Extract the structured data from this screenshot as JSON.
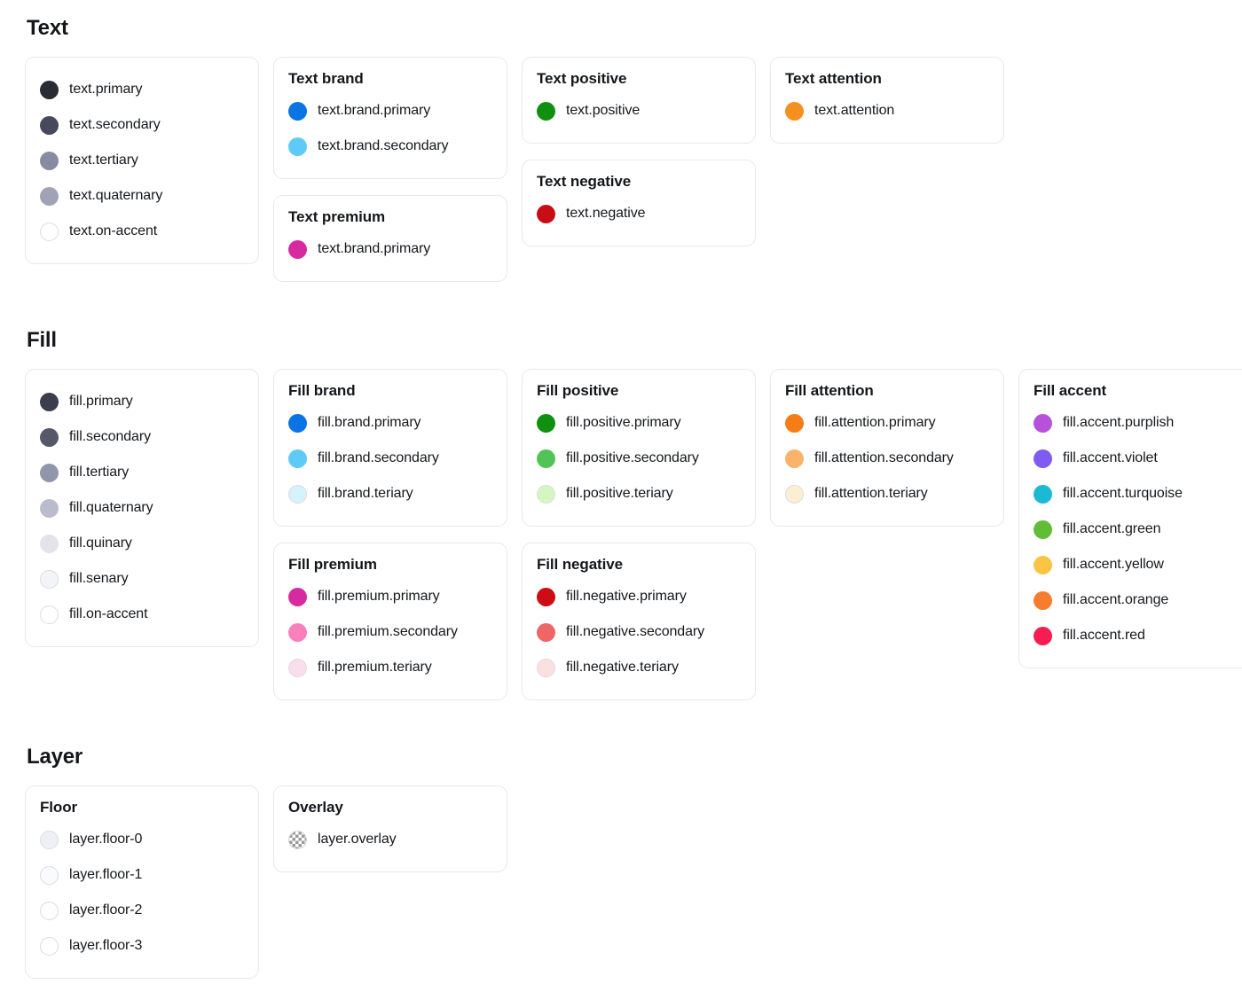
{
  "sections": [
    {
      "id": "text",
      "title": "Text",
      "columns": [
        {
          "cards": [
            {
              "title": null,
              "name": "text-base-card",
              "tokens": [
                {
                  "label": "text.primary",
                  "color": "#292b35",
                  "light": false
                },
                {
                  "label": "text.secondary",
                  "color": "#474a5c",
                  "light": false
                },
                {
                  "label": "text.tertiary",
                  "color": "#888ca3",
                  "light": false
                },
                {
                  "label": "text.quaternary",
                  "color": "#a0a3b5",
                  "light": false
                },
                {
                  "label": "text.on-accent",
                  "color": "#ffffff",
                  "light": true
                }
              ]
            }
          ]
        },
        {
          "cards": [
            {
              "title": "Text brand",
              "name": "text-brand-card",
              "tokens": [
                {
                  "label": "text.brand.primary",
                  "color": "#0b74e5",
                  "light": false
                },
                {
                  "label": "text.brand.secondary",
                  "color": "#5ecbf7",
                  "light": false
                }
              ]
            },
            {
              "title": "Text premium",
              "name": "text-premium-card",
              "tokens": [
                {
                  "label": "text.brand.primary",
                  "color": "#d62ba0",
                  "light": false
                }
              ]
            }
          ]
        },
        {
          "cards": [
            {
              "title": "Text positive",
              "name": "text-positive-card",
              "tokens": [
                {
                  "label": "text.positive",
                  "color": "#109010",
                  "light": false
                }
              ]
            },
            {
              "title": "Text negative",
              "name": "text-negative-card",
              "tokens": [
                {
                  "label": "text.negative",
                  "color": "#c80d16",
                  "light": false
                }
              ]
            }
          ]
        },
        {
          "cards": [
            {
              "title": "Text attention",
              "name": "text-attention-card",
              "tokens": [
                {
                  "label": "text.attention",
                  "color": "#f5901e",
                  "light": false
                }
              ]
            }
          ]
        }
      ]
    },
    {
      "id": "fill",
      "title": "Fill",
      "columns": [
        {
          "cards": [
            {
              "title": null,
              "name": "fill-base-card",
              "tokens": [
                {
                  "label": "fill.primary",
                  "color": "#3b3e4c",
                  "light": false
                },
                {
                  "label": "fill.secondary",
                  "color": "#545869",
                  "light": false
                },
                {
                  "label": "fill.tertiary",
                  "color": "#9296ab",
                  "light": false
                },
                {
                  "label": "fill.quaternary",
                  "color": "#b9bcca",
                  "light": false
                },
                {
                  "label": "fill.quinary",
                  "color": "#e2e4ea",
                  "light": false
                },
                {
                  "label": "fill.senary",
                  "color": "#f2f4f8",
                  "light": true
                },
                {
                  "label": "fill.on-accent",
                  "color": "#ffffff",
                  "light": true
                }
              ]
            }
          ]
        },
        {
          "cards": [
            {
              "title": "Fill brand",
              "name": "fill-brand-card",
              "tokens": [
                {
                  "label": "fill.brand.primary",
                  "color": "#0b74e5",
                  "light": false
                },
                {
                  "label": "fill.brand.secondary",
                  "color": "#5ecbf7",
                  "light": false
                },
                {
                  "label": "fill.brand.teriary",
                  "color": "#d6f2fb",
                  "light": true
                }
              ]
            },
            {
              "title": "Fill premium",
              "name": "fill-premium-card",
              "tokens": [
                {
                  "label": "fill.premium.primary",
                  "color": "#d62ba0",
                  "light": false
                },
                {
                  "label": "fill.premium.secondary",
                  "color": "#fa7fbd",
                  "light": false
                },
                {
                  "label": "fill.premium.teriary",
                  "color": "#fbdeeb",
                  "light": true
                }
              ]
            }
          ]
        },
        {
          "cards": [
            {
              "title": "Fill positive",
              "name": "fill-positive-card",
              "tokens": [
                {
                  "label": "fill.positive.primary",
                  "color": "#109010",
                  "light": false
                },
                {
                  "label": "fill.positive.secondary",
                  "color": "#52c455",
                  "light": false
                },
                {
                  "label": "fill.positive.teriary",
                  "color": "#d4f7c2",
                  "light": true
                }
              ]
            },
            {
              "title": "Fill negative",
              "name": "fill-negative-card",
              "tokens": [
                {
                  "label": "fill.negative.primary",
                  "color": "#cd0c13",
                  "light": false
                },
                {
                  "label": "fill.negative.secondary",
                  "color": "#ef6666",
                  "light": false
                },
                {
                  "label": "fill.negative.teriary",
                  "color": "#fbe0e0",
                  "light": true
                }
              ]
            }
          ]
        },
        {
          "cards": [
            {
              "title": "Fill attention",
              "name": "fill-attention-card",
              "tokens": [
                {
                  "label": "fill.attention.primary",
                  "color": "#f57c16",
                  "light": false
                },
                {
                  "label": "fill.attention.secondary",
                  "color": "#fbb36c",
                  "light": false
                },
                {
                  "label": "fill.attention.teriary",
                  "color": "#fbeed1",
                  "light": true
                }
              ]
            }
          ]
        },
        {
          "cards": [
            {
              "title": "Fill accent",
              "name": "fill-accent-card",
              "tokens": [
                {
                  "label": "fill.accent.purplish",
                  "color": "#b751db",
                  "light": false
                },
                {
                  "label": "fill.accent.violet",
                  "color": "#7f5bf2",
                  "light": false
                },
                {
                  "label": "fill.accent.turquoise",
                  "color": "#1bb9d4",
                  "light": false
                },
                {
                  "label": "fill.accent.green",
                  "color": "#61bd35",
                  "light": false
                },
                {
                  "label": "fill.accent.yellow",
                  "color": "#fbc543",
                  "light": false
                },
                {
                  "label": "fill.accent.orange",
                  "color": "#f77c2e",
                  "light": false
                },
                {
                  "label": "fill.accent.red",
                  "color": "#f51d52",
                  "light": false
                }
              ]
            }
          ]
        }
      ]
    },
    {
      "id": "layer",
      "title": "Layer",
      "columns": [
        {
          "cards": [
            {
              "title": "Floor",
              "name": "layer-floor-card",
              "tokens": [
                {
                  "label": "layer.floor-0",
                  "color": "#eef0f5",
                  "light": true
                },
                {
                  "label": "layer.floor-1",
                  "color": "#fafbfd",
                  "light": true
                },
                {
                  "label": "layer.floor-2",
                  "color": "#fdfdfe",
                  "light": true
                },
                {
                  "label": "layer.floor-3",
                  "color": "#ffffff",
                  "light": true
                }
              ]
            }
          ]
        },
        {
          "cards": [
            {
              "title": "Overlay",
              "name": "layer-overlay-card",
              "tokens": [
                {
                  "label": "layer.overlay",
                  "color": "checker",
                  "light": false,
                  "checker": true
                }
              ]
            }
          ]
        }
      ]
    }
  ]
}
